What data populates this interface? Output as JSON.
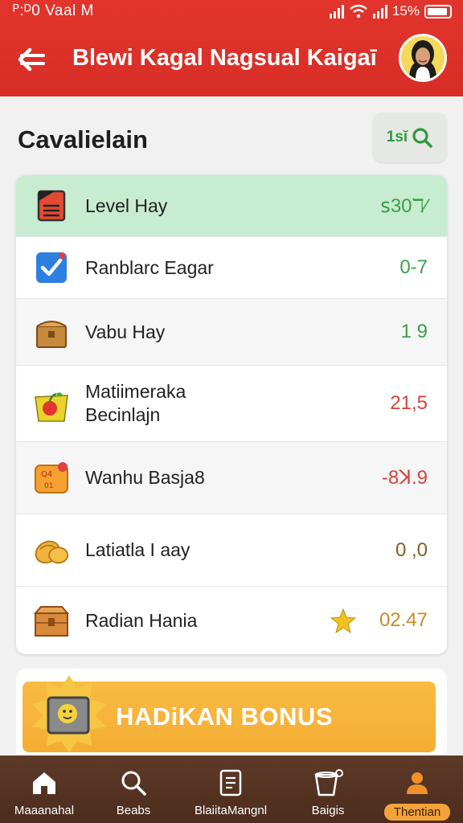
{
  "status_bar": {
    "time": "ᴾ:ᴰ0 Vaal M",
    "battery": "15%"
  },
  "app_bar": {
    "title": "Blewi Kagal Nagsual Kaigaī"
  },
  "section": {
    "title": "Cavalielain",
    "search_label": "1sĭ"
  },
  "list": [
    {
      "name": "Level Hay",
      "value": "ꜱ30ℸ⁄",
      "value_color": "#3aa04a",
      "icon": "red-document-icon"
    },
    {
      "name": "Ranblarc Eagar",
      "value": "0-7",
      "value_color": "#3aa04a",
      "icon": "checkbox-icon"
    },
    {
      "name": "Vabu Hay",
      "value": "1 9",
      "value_color": "#3aa04a",
      "icon": "treasure-box-icon"
    },
    {
      "name": "Matiimeraka\nBecinlajn",
      "value": "21,5",
      "value_color": "#d8433a",
      "icon": "fruit-basket-icon"
    },
    {
      "name": "Wanhu Basja8",
      "value": "-8ꓘ.9",
      "value_color": "#d8433a",
      "icon": "coupon-icon"
    },
    {
      "name": "Latiatla I aay",
      "value": "0 ,0",
      "value_color": "#8a5a26",
      "icon": "croissant-icon"
    },
    {
      "name": "Radian Hania",
      "value": "02.47",
      "value_color": "#c98a25",
      "icon": "wooden-crate-icon"
    }
  ],
  "bonus": {
    "label": "HADiKAN BONUS"
  },
  "bottom_nav": [
    {
      "label": "Maaanahal",
      "icon": "home-icon"
    },
    {
      "label": "Beabs",
      "icon": "search-icon"
    },
    {
      "label": "BlaiitaMangnl",
      "icon": "document-icon"
    },
    {
      "label": "Baigis",
      "icon": "bucket-icon"
    },
    {
      "label": "Thentian",
      "icon": "profile-icon",
      "active": true
    }
  ],
  "colors": {
    "primary": "#e2342c",
    "highlight_row": "#c8ecd0",
    "bonus": "#f7b23b",
    "nav_bg": "#553322",
    "nav_active": "#f3a33a"
  }
}
